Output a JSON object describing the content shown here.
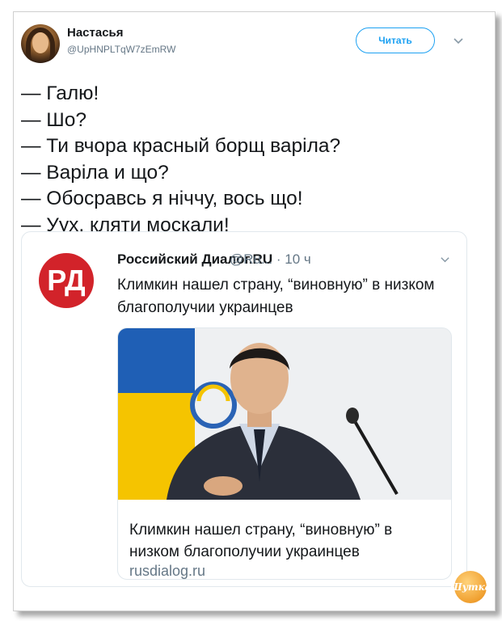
{
  "tweet": {
    "author_name": "Настасья",
    "author_handle": "@UpHNPLTqW7zEmRW",
    "follow_label": "Читать",
    "lines": [
      "— Галю!",
      "— Шо?",
      "— Ти вчора красный борщ варіла?",
      "— Варіла и що?",
      "— Обосравсь я ніччу, вось що!",
      "— Уух, кляти москали!"
    ]
  },
  "quoted": {
    "logo_text": "РД",
    "author_name": "Российский Диалог.RU",
    "meta": "@Ru... · 10 ч",
    "text": "Климкин нашел страну, “виновную” в низком благополучии украинцев",
    "link_title": "Климкин нашел страну, “виновную” в низком благополучии украинцев",
    "link_domain": "rusdialog.ru"
  },
  "watermark": "Шутка",
  "colors": {
    "accent": "#1da1f2",
    "logo_red": "#d2232a",
    "flag_blue": "#1f5fb5",
    "flag_yellow": "#f5c400"
  },
  "icons": {
    "dropdown": "chevron-down-icon",
    "follow": "follow-button"
  }
}
